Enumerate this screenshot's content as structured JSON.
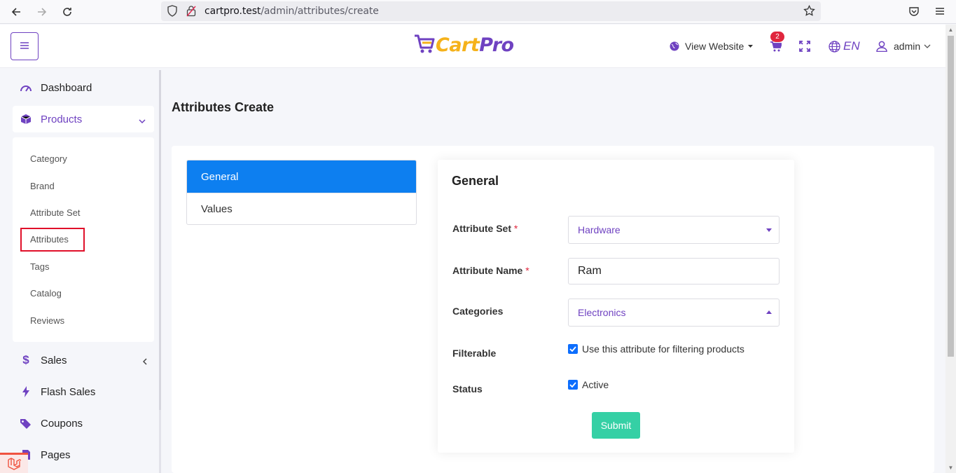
{
  "browser": {
    "url_host": "cartpro.test",
    "url_path": "/admin/attributes/create"
  },
  "header": {
    "logo_text_cart": "Cart",
    "logo_text_pro": "Pro",
    "view_website_label": "View Website",
    "cart_badge_count": "2",
    "language_label": "EN",
    "user_label": "admin"
  },
  "sidebar": {
    "items": [
      {
        "label": "Dashboard"
      },
      {
        "label": "Products"
      },
      {
        "label": "Sales"
      },
      {
        "label": "Flash Sales"
      },
      {
        "label": "Coupons"
      },
      {
        "label": "Pages"
      }
    ],
    "products_submenu": [
      {
        "label": "Category"
      },
      {
        "label": "Brand"
      },
      {
        "label": "Attribute Set"
      },
      {
        "label": "Attributes"
      },
      {
        "label": "Tags"
      },
      {
        "label": "Catalog"
      },
      {
        "label": "Reviews"
      }
    ]
  },
  "main": {
    "page_title": "Attributes Create",
    "tabs": [
      {
        "label": "General"
      },
      {
        "label": "Values"
      }
    ],
    "form": {
      "title": "General",
      "attribute_set_label": "Attribute Set",
      "attribute_set_value": "Hardware",
      "attribute_name_label": "Attribute Name",
      "attribute_name_value": "Ram",
      "categories_label": "Categories",
      "categories_value": "Electronics",
      "filterable_label": "Filterable",
      "filterable_checkbox_label": "Use this attribute for filtering products",
      "status_label": "Status",
      "status_checkbox_label": "Active",
      "required_mark": "*",
      "submit_label": "Submit"
    }
  },
  "colors": {
    "accent_purple": "#6f42c1",
    "primary_blue": "#0d7ff0",
    "submit_green": "#35d0a5",
    "logo_yellow": "#f5b21b",
    "badge_red": "#e0263d"
  }
}
